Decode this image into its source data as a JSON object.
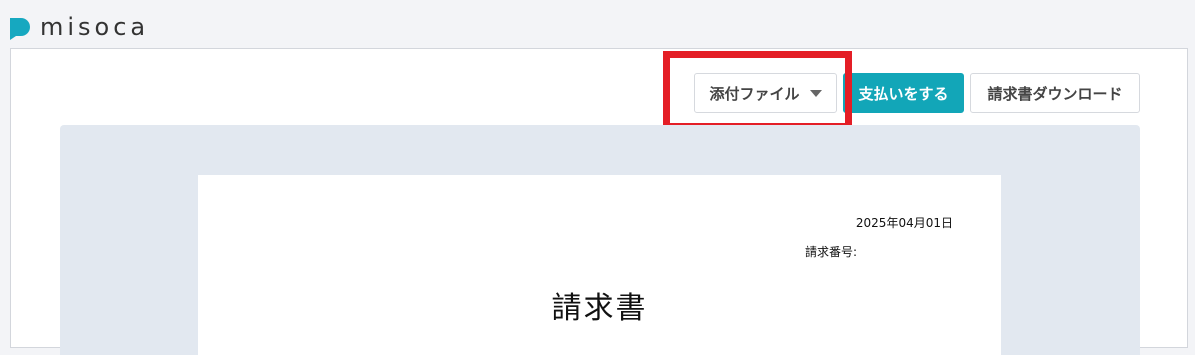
{
  "app": {
    "logo_text": "misoca",
    "brand_color": "#16a8c0"
  },
  "toolbar": {
    "attach_label": "添付ファイル",
    "pay_label": "支払いをする",
    "download_label": "請求書ダウンロード"
  },
  "document": {
    "date": "2025年04月01日",
    "invoice_number_label": "請求番号:",
    "title": "請求書"
  },
  "colors": {
    "pay_button": "#12a6b8",
    "highlight": "#e41e26",
    "preview_background": "#e2e8f0"
  }
}
